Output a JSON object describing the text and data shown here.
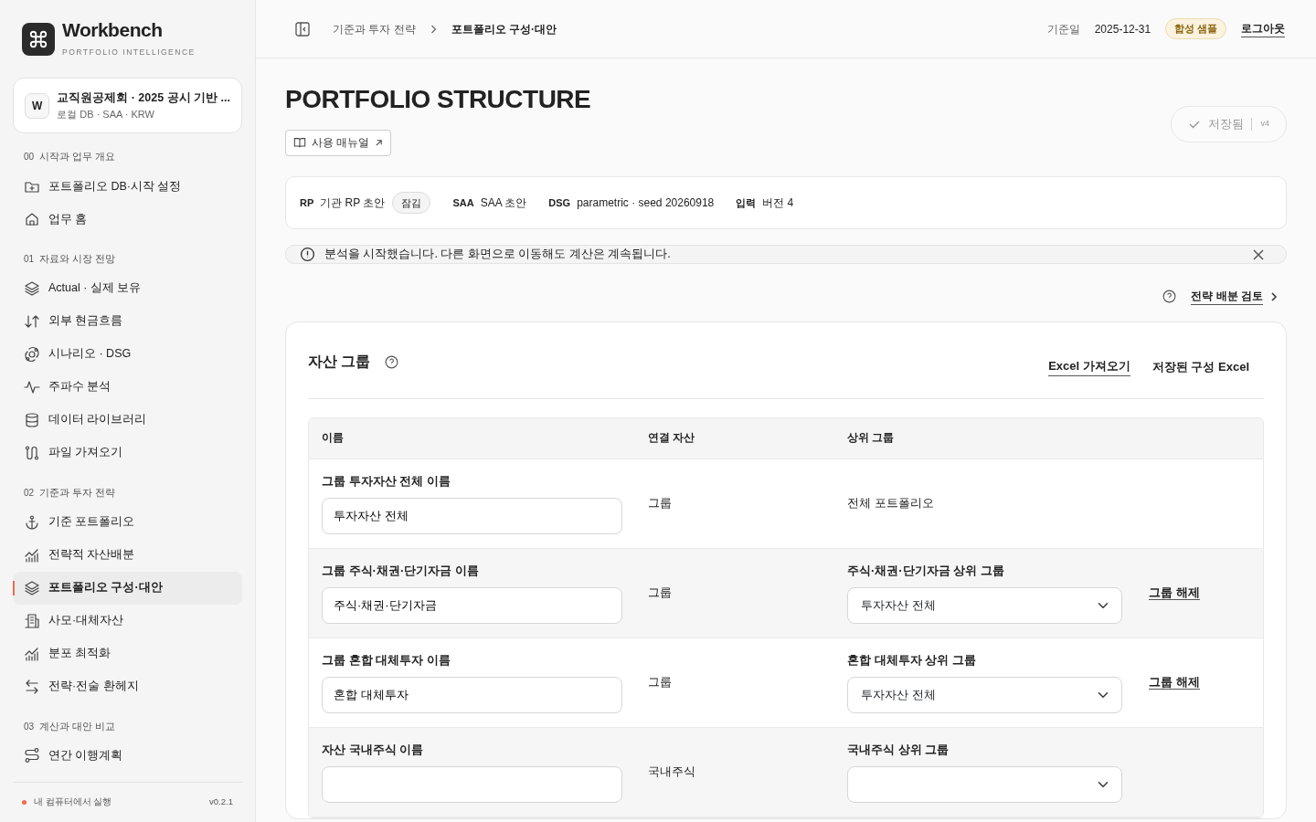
{
  "brand": {
    "name": "Workbench",
    "tagline": "PORTFOLIO INTELLIGENCE"
  },
  "workspace": {
    "avatar": "W",
    "title": "교직원공제회 · 2025 공시 기반 ...",
    "subtitle": "로컬 DB · SAA · KRW"
  },
  "sidebar": {
    "sections": [
      {
        "number": "00",
        "title": "시작과 업무 개요",
        "items": [
          {
            "label": "포트폴리오 DB·시작 설정",
            "selected": false
          },
          {
            "label": "업무 홈",
            "selected": false
          }
        ]
      },
      {
        "number": "01",
        "title": "자료와 시장 전망",
        "items": [
          {
            "label": "Actual · 실제 보유",
            "selected": false
          },
          {
            "label": "외부 현금흐름",
            "selected": false
          },
          {
            "label": "시나리오 · DSG",
            "selected": false
          },
          {
            "label": "주파수 분석",
            "selected": false
          },
          {
            "label": "데이터 라이브러리",
            "selected": false
          },
          {
            "label": "파일 가져오기",
            "selected": false
          }
        ]
      },
      {
        "number": "02",
        "title": "기준과 투자 전략",
        "items": [
          {
            "label": "기준 포트폴리오",
            "selected": false
          },
          {
            "label": "전략적 자산배분",
            "selected": false
          },
          {
            "label": "포트폴리오 구성·대안",
            "selected": true
          },
          {
            "label": "사모·대체자산",
            "selected": false
          },
          {
            "label": "분포 최적화",
            "selected": false
          },
          {
            "label": "전략·전술 환헤지",
            "selected": false
          }
        ]
      },
      {
        "number": "03",
        "title": "계산과 대안 비교",
        "items": [
          {
            "label": "연간 이행계획",
            "selected": false
          }
        ]
      }
    ],
    "footer": {
      "status": "내 컴퓨터에서 실행",
      "version": "v0.2.1"
    }
  },
  "topbar": {
    "breadcrumb": [
      "기준과 투자 전략",
      "포트폴리오 구성·대안"
    ],
    "date_label": "기준일",
    "date": "2025-12-31",
    "badge": "합성 샘플",
    "logout": "로그아웃"
  },
  "page": {
    "title": "PORTFOLIO STRUCTURE",
    "manual_button": "사용 매뉴얼",
    "save_status": "저장됨",
    "version": "v4"
  },
  "summary": [
    {
      "key": "RP",
      "value": "기관 RP 초안",
      "tag": "잠김"
    },
    {
      "key": "SAA",
      "value": "SAA 초안"
    },
    {
      "key": "DSG",
      "value": "parametric · seed 20260918"
    },
    {
      "key": "입력",
      "value": "버전 4"
    }
  ],
  "alert": {
    "message": "분석을 시작했습니다. 다른 화면으로 이동해도 계산은 계속됩니다."
  },
  "review_link": "전략 배분 검토",
  "groups": {
    "title": "자산 그룹",
    "actions": [
      "Excel 가져오기",
      "저장된 구성 Excel"
    ],
    "columns": [
      "이름",
      "연결 자산",
      "상위 그룹"
    ],
    "rows": [
      {
        "name_label": "그룹 투자자산 전체 이름",
        "name": "투자자산 전체",
        "linked": "그룹",
        "kind": "fixed",
        "parent": "전체 포트폴리오"
      },
      {
        "name_label": "그룹 주식·채권·단기자금 이름",
        "name": "주식·채권·단기자금",
        "linked": "그룹",
        "kind": "select",
        "parent_label": "주식·채권·단기자금 상위 그룹",
        "parent": "투자자산 전체",
        "action": "그룹 해제"
      },
      {
        "name_label": "그룹 혼합 대체투자 이름",
        "name": "혼합 대체투자",
        "linked": "그룹",
        "kind": "select",
        "parent_label": "혼합 대체투자 상위 그룹",
        "parent": "투자자산 전체",
        "action": "그룹 해제"
      },
      {
        "name_label": "자산 국내주식 이름",
        "linked": "국내주식",
        "kind": "select",
        "parent_label": "국내주식 상위 그룹"
      }
    ]
  }
}
